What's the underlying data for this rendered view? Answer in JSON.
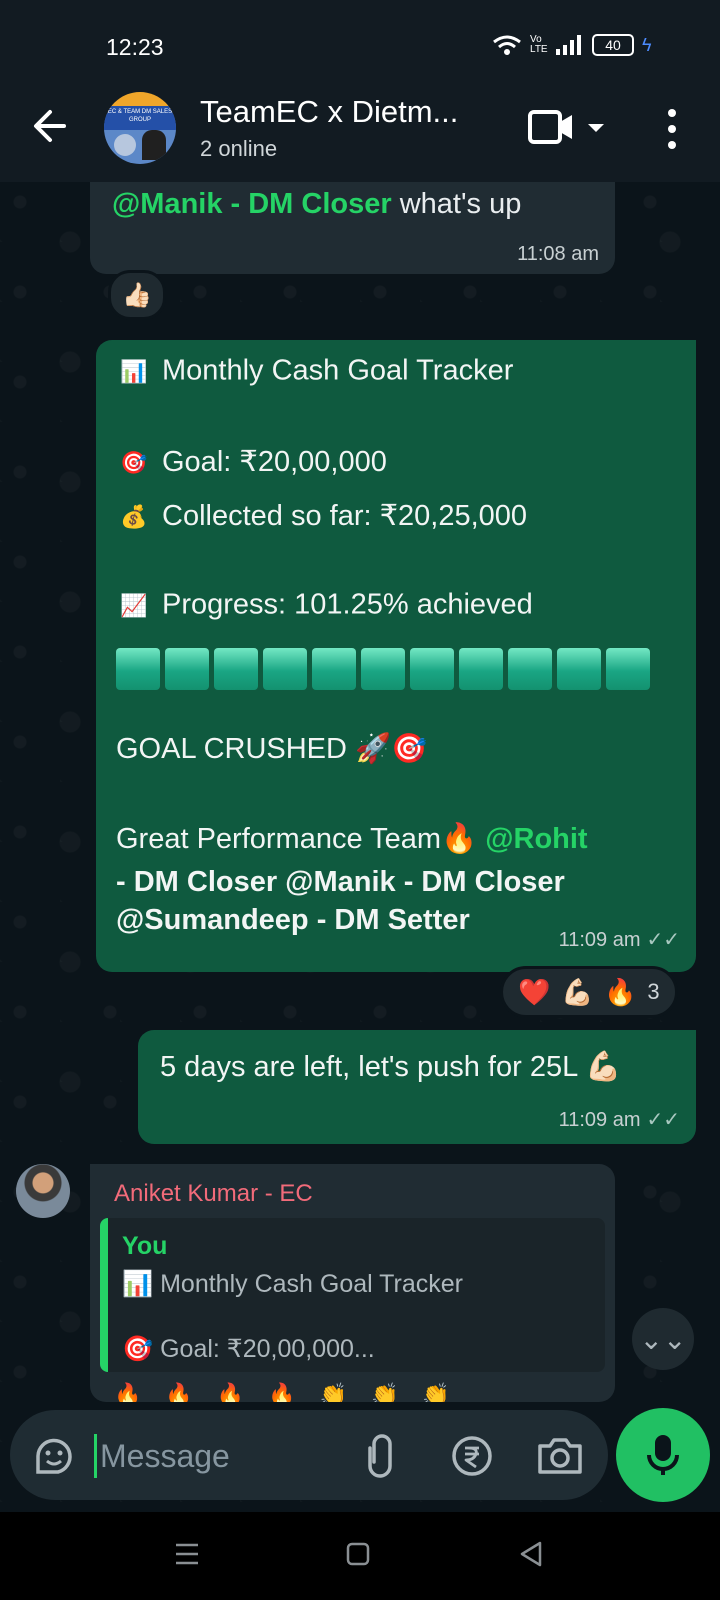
{
  "status_bar": {
    "time": "12:23",
    "network_label": "Vo LTE",
    "battery": "40"
  },
  "header": {
    "title": "TeamEC x Dietm...",
    "subtitle": "2 online",
    "avatar_text": "EC & TEAM DM SALES GROUP"
  },
  "messages": [
    {
      "mention": "@Manik - DM Closer",
      "text": " what's up",
      "time": "11:08 am",
      "reaction": "👍🏻"
    },
    {
      "lines": {
        "title": "Monthly Cash Goal Tracker",
        "title_emoji": "📊",
        "goal_emoji": "🎯",
        "goal": "Goal: ₹20,00,000",
        "collected_emoji": "💰",
        "collected": "Collected so far: ₹20,25,000",
        "progress_emoji": "📈",
        "progress": "Progress: 101.25% achieved",
        "progress_fraction": 1.0,
        "progress_blocks": 11,
        "crushed": "GOAL CRUSHED 🚀🎯",
        "perf": "Great Performance Team🔥",
        "mention_1": "@Rohit",
        "mention_2": "- DM Closer @Manik - DM Closer",
        "mention_3": "@Sumandeep - DM Setter"
      },
      "time": "11:09 am",
      "reactions": [
        "❤️",
        "💪🏻",
        "🔥"
      ],
      "reaction_count": "3"
    },
    {
      "text": "5 days are left, let's push for 25L 💪🏻",
      "time": "11:09 am"
    },
    {
      "sender": "Aniket Kumar - EC",
      "quote_author": "You",
      "quote_line1_emoji": "📊",
      "quote_line1": "Monthly Cash Goal Tracker",
      "quote_line2_emoji": "🎯",
      "quote_line2": "Goal: ₹20,00,000...",
      "reply_emojis": "🔥🔥🔥🔥👏👏👏"
    }
  ],
  "composer": {
    "placeholder": "Message"
  },
  "icons": {
    "read_ticks": "✓✓",
    "scroll_down": "⌄⌄"
  }
}
